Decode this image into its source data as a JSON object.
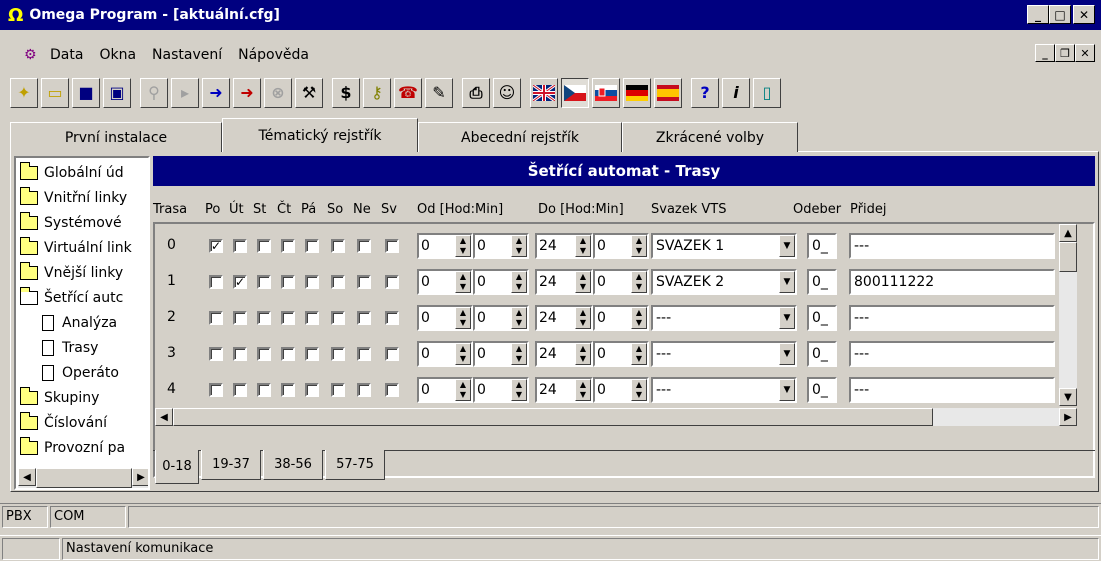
{
  "window": {
    "title": "Omega Program - [aktuální.cfg]",
    "omega_symbol": "Ω"
  },
  "menu": [
    "Data",
    "Okna",
    "Nastavení",
    "Nápověda"
  ],
  "toolbar": [
    "new-icon",
    "open-folder-icon",
    "save-icon",
    "save-all-icon",
    "connect-icon",
    "stop-icon",
    "upload-icon",
    "download-icon",
    "cancel-icon",
    "tools-icon",
    "dollar-icon",
    "key-icon",
    "phone-icon",
    "document-edit-icon",
    "print-icon",
    "user-icon",
    "flag-uk-icon",
    "flag-cz-icon",
    "flag-sk-icon",
    "flag-de-icon",
    "flag-es-icon",
    "help-icon",
    "info-icon",
    "exit-icon"
  ],
  "tabs": [
    "První instalace",
    "Tématický rejstřík",
    "Abecední rejstřík",
    "Zkrácené volby"
  ],
  "active_tab": 1,
  "tree": [
    {
      "label": "Globální úd",
      "type": "folder",
      "indent": 0
    },
    {
      "label": "Vnitřní linky",
      "type": "folder",
      "indent": 0
    },
    {
      "label": "Systémové",
      "type": "folder",
      "indent": 0
    },
    {
      "label": "Virtuální link",
      "type": "folder",
      "indent": 0
    },
    {
      "label": "Vnější linky",
      "type": "folder",
      "indent": 0
    },
    {
      "label": "Šetřící autc",
      "type": "folder-open",
      "indent": 0
    },
    {
      "label": "Analýza",
      "type": "doc",
      "indent": 1
    },
    {
      "label": "Trasy",
      "type": "doc",
      "indent": 1
    },
    {
      "label": "Operáto",
      "type": "doc",
      "indent": 1
    },
    {
      "label": "Skupiny",
      "type": "folder",
      "indent": 0
    },
    {
      "label": "Číslování",
      "type": "folder",
      "indent": 0
    },
    {
      "label": "Provozní pa",
      "type": "folder",
      "indent": 0
    }
  ],
  "panel": {
    "title": "Šetřící automat - Trasy",
    "headers": {
      "trasa": "Trasa",
      "days": [
        "Po",
        "Út",
        "St",
        "Čt",
        "Pá",
        "So",
        "Ne",
        "Sv"
      ],
      "od": "Od [Hod:Min]",
      "do": "Do [Hod:Min]",
      "svazek": "Svazek VTS",
      "odeber": "Odeber",
      "pridej": "Přidej"
    },
    "rows": [
      {
        "num": "0",
        "days": [
          true,
          false,
          false,
          false,
          false,
          false,
          false,
          false
        ],
        "od_h": "0",
        "od_m": "0",
        "do_h": "24",
        "do_m": "0",
        "svazek": "SVAZEK 1",
        "odeber": "0_",
        "pridej": "---"
      },
      {
        "num": "1",
        "days": [
          false,
          true,
          false,
          false,
          false,
          false,
          false,
          false
        ],
        "od_h": "0",
        "od_m": "0",
        "do_h": "24",
        "do_m": "0",
        "svazek": "SVAZEK 2",
        "odeber": "0_",
        "pridej": "800111222"
      },
      {
        "num": "2",
        "days": [
          false,
          false,
          false,
          false,
          false,
          false,
          false,
          false
        ],
        "od_h": "0",
        "od_m": "0",
        "do_h": "24",
        "do_m": "0",
        "svazek": "---",
        "odeber": "0_",
        "pridej": "---"
      },
      {
        "num": "3",
        "days": [
          false,
          false,
          false,
          false,
          false,
          false,
          false,
          false
        ],
        "od_h": "0",
        "od_m": "0",
        "do_h": "24",
        "do_m": "0",
        "svazek": "---",
        "odeber": "0_",
        "pridej": "---"
      },
      {
        "num": "4",
        "days": [
          false,
          false,
          false,
          false,
          false,
          false,
          false,
          false
        ],
        "od_h": "0",
        "od_m": "0",
        "do_h": "24",
        "do_m": "0",
        "svazek": "---",
        "odeber": "0_",
        "pridej": "---"
      }
    ],
    "pages": [
      "0-18",
      "19-37",
      "38-56",
      "57-75"
    ],
    "active_page": 0
  },
  "status": {
    "pane1": "PBX",
    "pane2": "COM",
    "message": "Nastavení komunikace"
  },
  "colors": {
    "titlebar": "#000080",
    "face": "#d4d0c8"
  }
}
